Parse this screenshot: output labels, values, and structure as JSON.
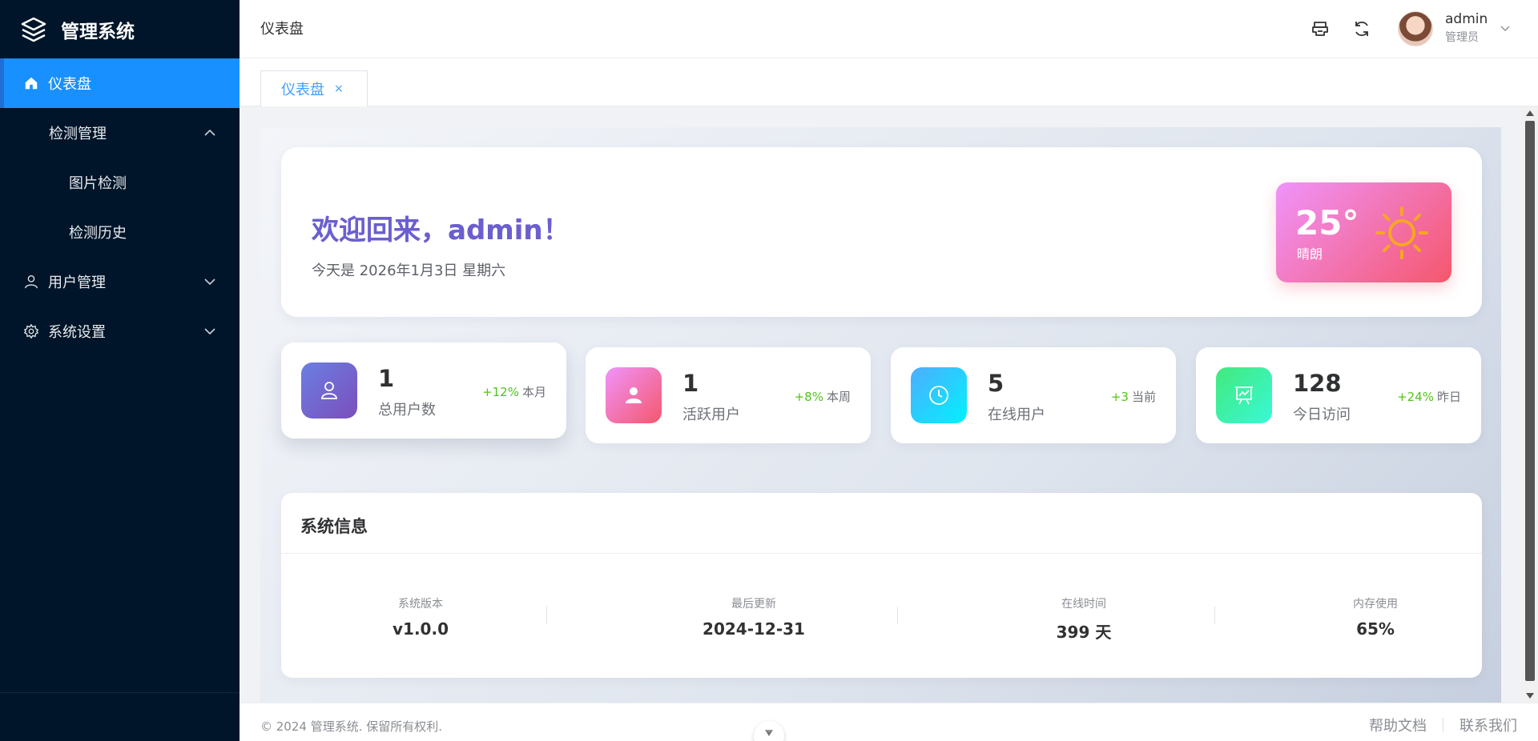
{
  "app": {
    "title": "管理系统"
  },
  "sidebar": {
    "items": [
      {
        "label": "仪表盘",
        "icon": "home-icon",
        "active": true
      },
      {
        "label": "检测管理",
        "expanded": true
      },
      {
        "label": "图片检测"
      },
      {
        "label": "检测历史"
      },
      {
        "label": "用户管理",
        "icon": "user-icon",
        "expanded": false
      },
      {
        "label": "系统设置",
        "icon": "gear-icon",
        "expanded": false
      }
    ]
  },
  "header": {
    "breadcrumb": "仪表盘",
    "user": {
      "name": "admin",
      "role": "管理员"
    }
  },
  "tabs": [
    {
      "label": "仪表盘",
      "close": "×"
    }
  ],
  "welcome": {
    "title": "欢迎回来，admin！",
    "date": "今天是 2026年1月3日 星期六"
  },
  "weather": {
    "temp": "25°",
    "condition": "晴朗"
  },
  "stats": [
    {
      "value": "1",
      "label": "总用户数",
      "trend": "+12%",
      "period": "本月",
      "icon": "user-outline-icon",
      "gradient": [
        "#6b7fe3",
        "#7b4ebb"
      ]
    },
    {
      "value": "1",
      "label": "活跃用户",
      "trend": "+8%",
      "period": "本周",
      "icon": "user-solid-icon",
      "gradient": [
        "#f093fb",
        "#f5576c"
      ]
    },
    {
      "value": "5",
      "label": "在线用户",
      "trend": "+3",
      "period": "当前",
      "icon": "clock-icon",
      "gradient": [
        "#4facfe",
        "#00f2fe"
      ]
    },
    {
      "value": "128",
      "label": "今日访问",
      "trend": "+24%",
      "period": "昨日",
      "icon": "presentation-chart-icon",
      "gradient": [
        "#43e97b",
        "#38f9d7"
      ]
    }
  ],
  "system_info": {
    "title": "系统信息",
    "items": [
      {
        "label": "系统版本",
        "value": "v1.0.0"
      },
      {
        "label": "最后更新",
        "value": "2024-12-31"
      },
      {
        "label": "在线时间",
        "value": "399 天"
      },
      {
        "label": "内存使用",
        "value": "65%"
      }
    ]
  },
  "footer": {
    "copyright": "© 2024 管理系统. 保留所有权利.",
    "links": [
      "帮助文档",
      "联系我们"
    ]
  },
  "colors": {
    "sidebar_bg": "#001529",
    "accent": "#1890ff",
    "trend_up": "#52c41a"
  }
}
